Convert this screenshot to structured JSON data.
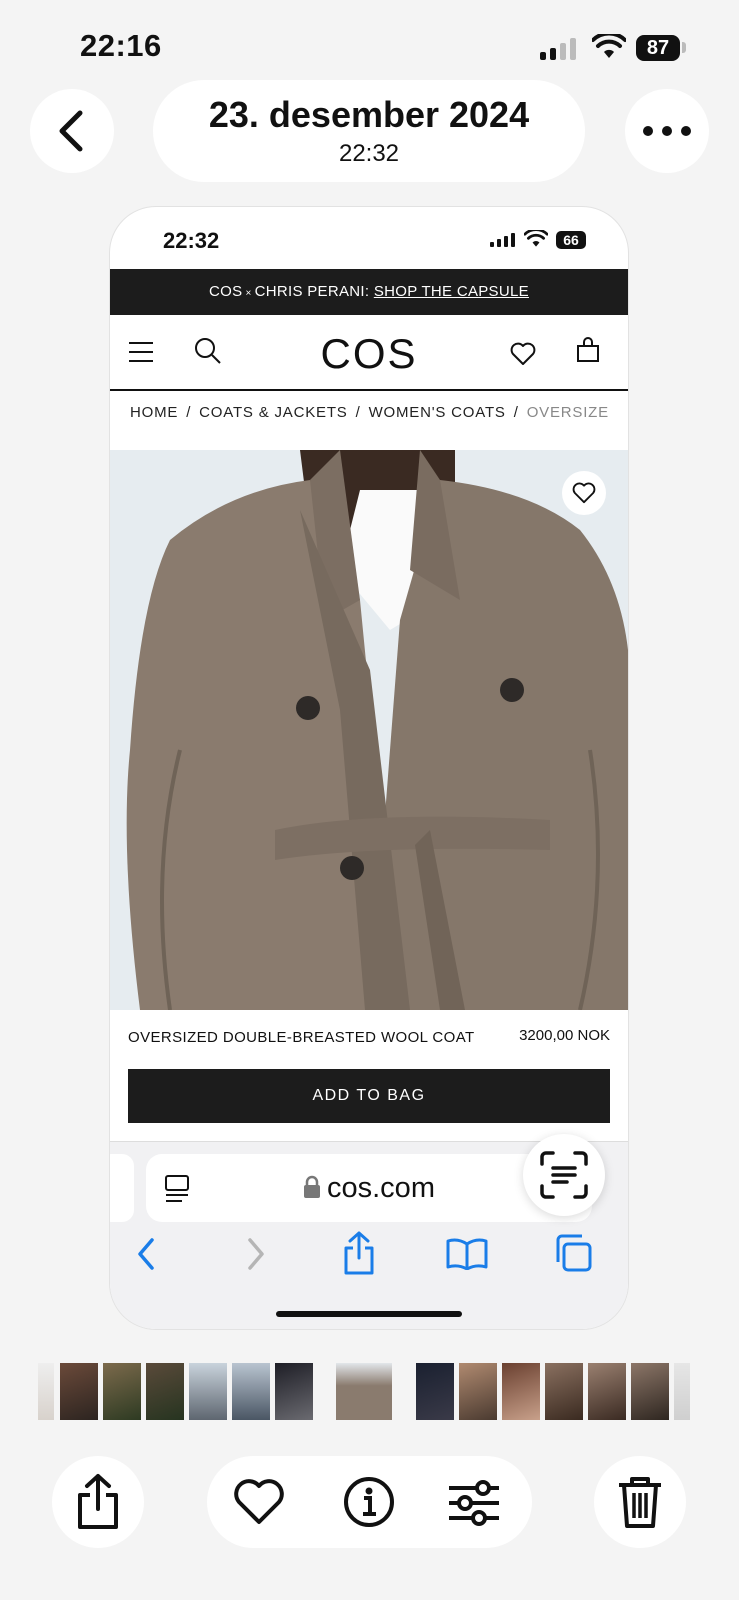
{
  "status_bar": {
    "time": "22:16",
    "battery": "87"
  },
  "nav": {
    "date": "23. desember 2024",
    "time": "22:32"
  },
  "screenshot": {
    "status_bar": {
      "time": "22:32",
      "battery": "66"
    },
    "banner": {
      "prefix": "COS",
      "cross": "×",
      "collab": "CHRIS PERANI:",
      "link": "SHOP THE CAPSULE"
    },
    "logo": "COS",
    "breadcrumb": [
      {
        "label": "HOME"
      },
      {
        "label": "COATS & JACKETS"
      },
      {
        "label": "WOMEN'S COATS"
      },
      {
        "label": "OVERSIZE"
      }
    ],
    "breadcrumb_separator": "/",
    "product": {
      "name": "OVERSIZED DOUBLE-BREASTED WOOL COAT",
      "price": "3200,00 NOK",
      "add_to_bag": "ADD TO BAG"
    },
    "safari": {
      "url": "cos.com"
    }
  },
  "colors": {
    "accent": "#1a7de8",
    "dark": "#1c1c1c",
    "coat": "#8a7b6e"
  }
}
